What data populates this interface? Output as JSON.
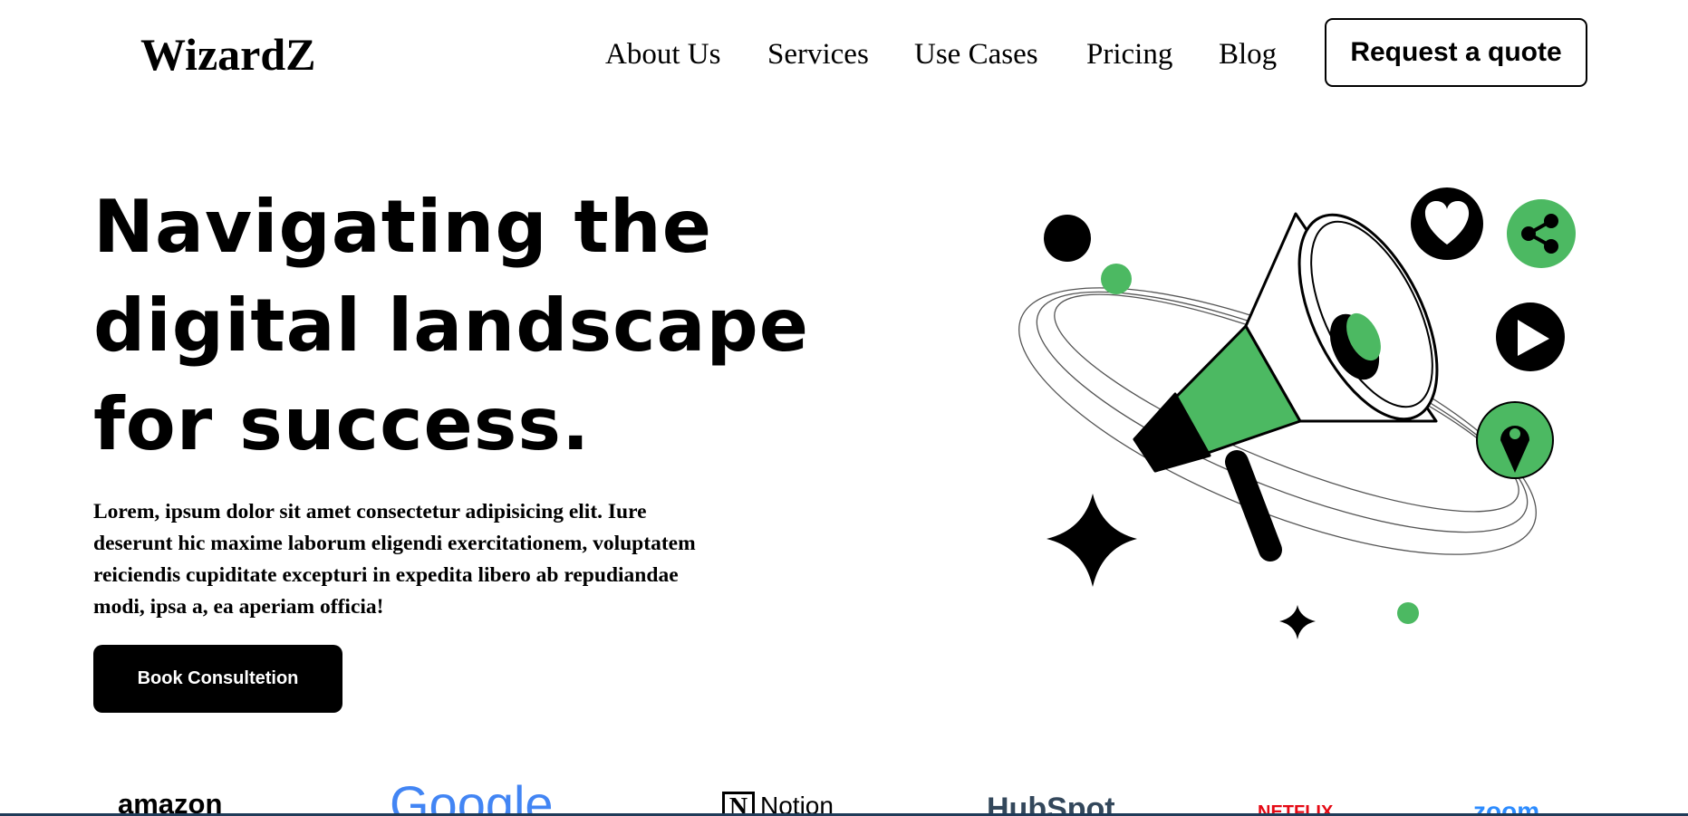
{
  "brand": {
    "name": "WizardZ"
  },
  "nav": {
    "items": [
      "About Us",
      "Services",
      "Use Cases",
      "Pricing",
      "Blog"
    ],
    "cta_label": "Request a quote"
  },
  "hero": {
    "title_lines": [
      "Navigating the",
      "digital landscape",
      "for success."
    ],
    "body": "Lorem, ipsum dolor sit amet consectetur adipisicing elit. Iure deserunt hic maxime laborum eligendi exercitationem, voluptatem reiciendis cupiditate excepturi in expedita libero ab repudiandae modi, ipsa a, ea aperiam officia!",
    "cta_label": "Book Consultetion"
  },
  "illustration": {
    "icons": [
      "megaphone-icon",
      "heart-icon",
      "share-icon",
      "play-icon",
      "location-pin-icon",
      "sparkle-icon"
    ],
    "accent_color": "#4cb962"
  },
  "logos": {
    "items": [
      {
        "name": "amazon",
        "color": "#000000"
      },
      {
        "name": "Google",
        "color": "#4285f4"
      },
      {
        "name": "Notion",
        "color": "#000000"
      },
      {
        "name": "HubSpot",
        "color": "#33475b"
      },
      {
        "name": "NETFLIX",
        "color": "#e50914"
      },
      {
        "name": "zoom",
        "color": "#2d8cff"
      }
    ]
  },
  "colors": {
    "accent": "#4cb962",
    "text": "#000000",
    "background": "#ffffff"
  }
}
